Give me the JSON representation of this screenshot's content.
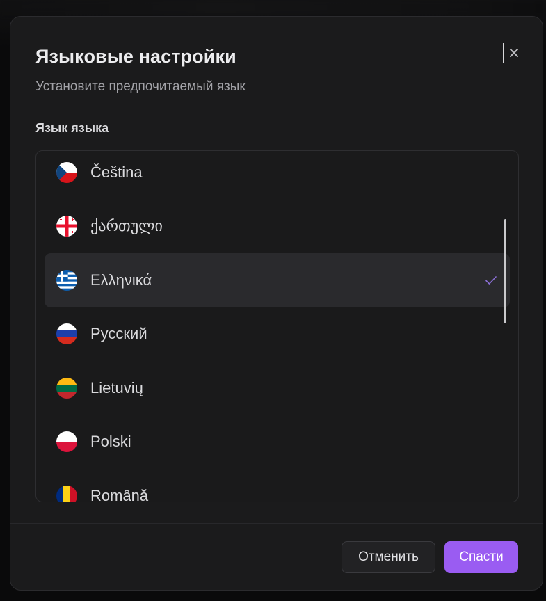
{
  "dialog": {
    "title": "Языковые настройки",
    "subtitle": "Установите предпочитаемый язык",
    "field_label": "Язык языка",
    "close_icon": "close-icon"
  },
  "languages": [
    {
      "label": "Čeština",
      "flag": "czech-flag-icon",
      "selected": false
    },
    {
      "label": "ქართული",
      "flag": "georgian-flag-icon",
      "selected": false
    },
    {
      "label": "Ελληνικά",
      "flag": "greek-flag-icon",
      "selected": true
    },
    {
      "label": "Русский",
      "flag": "russian-flag-icon",
      "selected": false
    },
    {
      "label": "Lietuvių",
      "flag": "lithuanian-flag-icon",
      "selected": false
    },
    {
      "label": "Polski",
      "flag": "polish-flag-icon",
      "selected": false
    },
    {
      "label": "Română",
      "flag": "romanian-flag-icon",
      "selected": false
    }
  ],
  "footer": {
    "cancel_label": "Отменить",
    "save_label": "Спасти"
  },
  "colors": {
    "accent": "#9a5cf2",
    "dialog_bg": "#1b1b1c",
    "selected_row": "#2a2a2d",
    "check": "#8b6fd6"
  }
}
